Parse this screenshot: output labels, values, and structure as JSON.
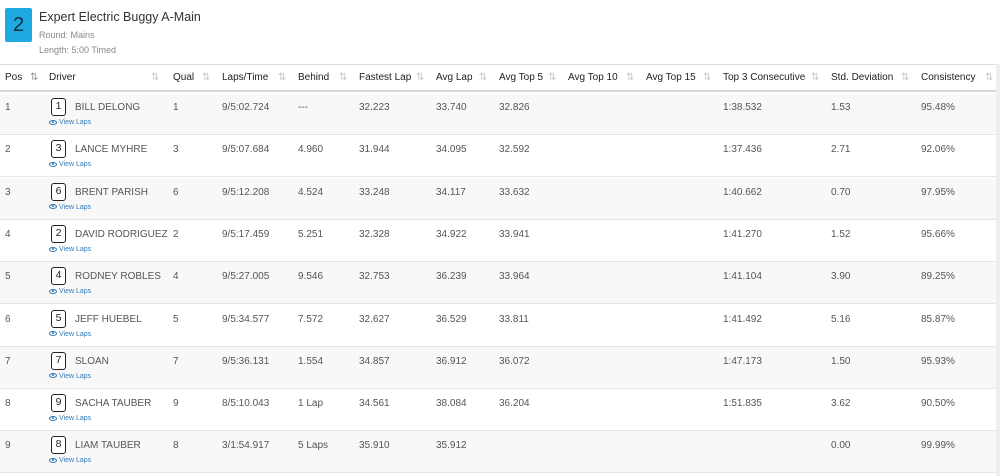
{
  "race": {
    "number": "2",
    "title": "Expert Electric Buggy A-Main",
    "round": "Round: Mains",
    "length": "Length: 5:00 Timed"
  },
  "columns": {
    "pos": "Pos",
    "driver": "Driver",
    "qual": "Qual",
    "laps_time": "Laps/Time",
    "behind": "Behind",
    "fastest_lap": "Fastest Lap",
    "avg_lap": "Avg Lap",
    "avg_top5": "Avg Top 5",
    "avg_top10": "Avg Top 10",
    "avg_top15": "Avg Top 15",
    "top3_consecutive": "Top 3 Consecutive",
    "std_deviation": "Std. Deviation",
    "consistency": "Consistency"
  },
  "view_laps_label": "View Laps",
  "rows": [
    {
      "pos": "1",
      "car": "1",
      "driver": "BILL DELONG",
      "qual": "1",
      "laps_time": "9/5:02.724",
      "behind": "---",
      "fastest_lap": "32.223",
      "avg_lap": "33.740",
      "avg_top5": "32.826",
      "avg_top10": "",
      "avg_top15": "",
      "top3_consecutive": "1:38.532",
      "std_deviation": "1.53",
      "consistency": "95.48%"
    },
    {
      "pos": "2",
      "car": "3",
      "driver": "LANCE MYHRE",
      "qual": "3",
      "laps_time": "9/5:07.684",
      "behind": "4.960",
      "fastest_lap": "31.944",
      "avg_lap": "34.095",
      "avg_top5": "32.592",
      "avg_top10": "",
      "avg_top15": "",
      "top3_consecutive": "1:37.436",
      "std_deviation": "2.71",
      "consistency": "92.06%"
    },
    {
      "pos": "3",
      "car": "6",
      "driver": "BRENT PARISH",
      "qual": "6",
      "laps_time": "9/5:12.208",
      "behind": "4.524",
      "fastest_lap": "33.248",
      "avg_lap": "34.117",
      "avg_top5": "33.632",
      "avg_top10": "",
      "avg_top15": "",
      "top3_consecutive": "1:40.662",
      "std_deviation": "0.70",
      "consistency": "97.95%"
    },
    {
      "pos": "4",
      "car": "2",
      "driver": "DAVID RODRIGUEZ",
      "qual": "2",
      "laps_time": "9/5:17.459",
      "behind": "5.251",
      "fastest_lap": "32.328",
      "avg_lap": "34.922",
      "avg_top5": "33.941",
      "avg_top10": "",
      "avg_top15": "",
      "top3_consecutive": "1:41.270",
      "std_deviation": "1.52",
      "consistency": "95.66%"
    },
    {
      "pos": "5",
      "car": "4",
      "driver": "RODNEY ROBLES",
      "qual": "4",
      "laps_time": "9/5:27.005",
      "behind": "9.546",
      "fastest_lap": "32.753",
      "avg_lap": "36.239",
      "avg_top5": "33.964",
      "avg_top10": "",
      "avg_top15": "",
      "top3_consecutive": "1:41.104",
      "std_deviation": "3.90",
      "consistency": "89.25%"
    },
    {
      "pos": "6",
      "car": "5",
      "driver": "JEFF HUEBEL",
      "qual": "5",
      "laps_time": "9/5:34.577",
      "behind": "7.572",
      "fastest_lap": "32.627",
      "avg_lap": "36.529",
      "avg_top5": "33.811",
      "avg_top10": "",
      "avg_top15": "",
      "top3_consecutive": "1:41.492",
      "std_deviation": "5.16",
      "consistency": "85.87%"
    },
    {
      "pos": "7",
      "car": "7",
      "driver": "SLOAN",
      "qual": "7",
      "laps_time": "9/5:36.131",
      "behind": "1.554",
      "fastest_lap": "34.857",
      "avg_lap": "36.912",
      "avg_top5": "36.072",
      "avg_top10": "",
      "avg_top15": "",
      "top3_consecutive": "1:47.173",
      "std_deviation": "1.50",
      "consistency": "95.93%"
    },
    {
      "pos": "8",
      "car": "9",
      "driver": "SACHA TAUBER",
      "qual": "9",
      "laps_time": "8/5:10.043",
      "behind": "1 Lap",
      "fastest_lap": "34.561",
      "avg_lap": "38.084",
      "avg_top5": "36.204",
      "avg_top10": "",
      "avg_top15": "",
      "top3_consecutive": "1:51.835",
      "std_deviation": "3.62",
      "consistency": "90.50%"
    },
    {
      "pos": "9",
      "car": "8",
      "driver": "LIAM TAUBER",
      "qual": "8",
      "laps_time": "3/1:54.917",
      "behind": "5 Laps",
      "fastest_lap": "35.910",
      "avg_lap": "35.912",
      "avg_top5": "",
      "avg_top10": "",
      "avg_top15": "",
      "top3_consecutive": "",
      "std_deviation": "0.00",
      "consistency": "99.99%"
    }
  ],
  "colors": {
    "badge": "#1ea9e0",
    "link": "#337ab7",
    "row_alt": "#f8f8f8"
  }
}
